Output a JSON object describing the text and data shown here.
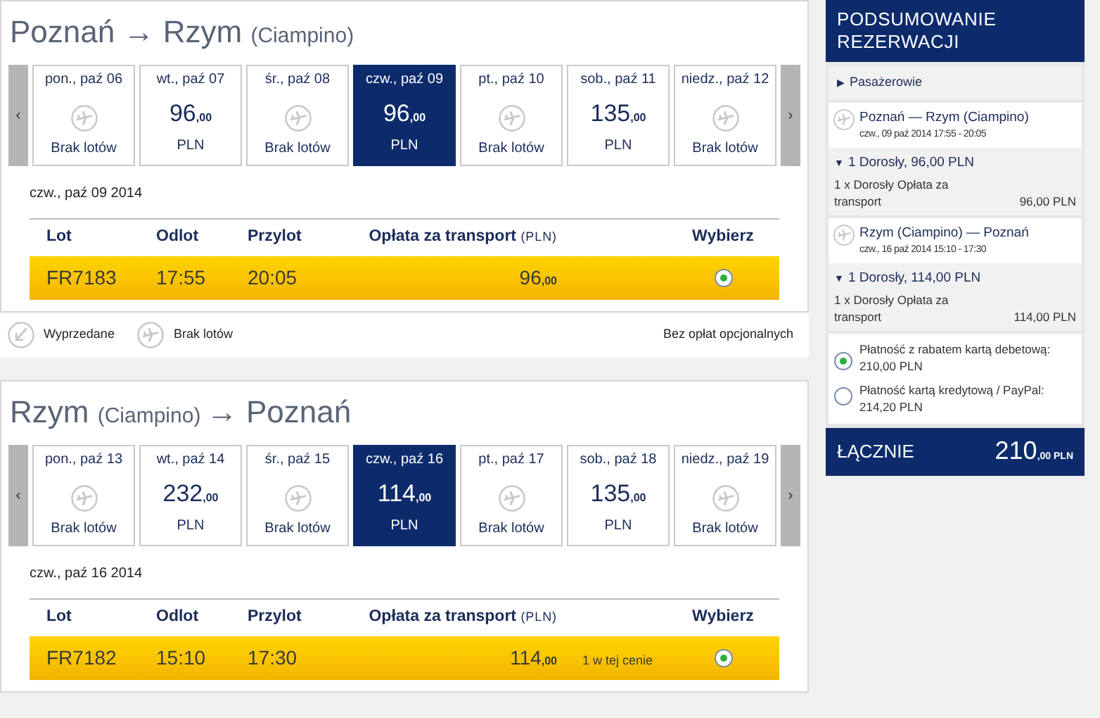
{
  "journeys": [
    {
      "title": [
        {
          "kind": "city",
          "text": "Poznań"
        },
        {
          "kind": "arrow",
          "text": "→"
        },
        {
          "kind": "city",
          "text": "Rzym"
        },
        {
          "kind": "sub",
          "text": "(Ciampino)"
        }
      ],
      "prev": "‹",
      "next": "›",
      "days": [
        {
          "label": "pon., paź 06",
          "kind": "none",
          "text": "Brak lotów",
          "selected": false
        },
        {
          "label": "wt., paź 07",
          "kind": "price",
          "amount": "96",
          "decimals": ",00",
          "currency": "PLN",
          "selected": false
        },
        {
          "label": "śr., paź 08",
          "kind": "none",
          "text": "Brak lotów",
          "selected": false
        },
        {
          "label": "czw., paź 09",
          "kind": "price",
          "amount": "96",
          "decimals": ",00",
          "currency": "PLN",
          "selected": true
        },
        {
          "label": "pt., paź 10",
          "kind": "none",
          "text": "Brak lotów",
          "selected": false
        },
        {
          "label": "sob., paź 11",
          "kind": "price",
          "amount": "135",
          "decimals": ",00",
          "currency": "PLN",
          "selected": false
        },
        {
          "label": "niedz., paź 12",
          "kind": "none",
          "text": "Brak lotów",
          "selected": false
        }
      ],
      "date": "czw., paź 09 2014",
      "columns": [
        "Lot",
        "Odlot",
        "Przylot",
        "Opłata za transport",
        "(PLN)",
        "Wybierz"
      ],
      "flights": [
        {
          "number": "FR7183",
          "departure": "17:55",
          "arrival": "20:05",
          "amount": "96",
          "decimals": ",00",
          "selected": true
        }
      ],
      "legend": {
        "sold_out": "Wyprzedane",
        "no_flights": "Brak lotów",
        "note": "Bez opłat opcjonalnych"
      }
    },
    {
      "title": [
        {
          "kind": "city",
          "text": "Rzym"
        },
        {
          "kind": "sub",
          "text": "(Ciampino)"
        },
        {
          "kind": "arrow",
          "text": "→"
        },
        {
          "kind": "city",
          "text": "Poznań"
        }
      ],
      "prev": "‹",
      "next": "›",
      "days": [
        {
          "label": "pon., paź 13",
          "kind": "none",
          "text": "Brak lotów",
          "selected": false
        },
        {
          "label": "wt., paź 14",
          "kind": "price",
          "amount": "232",
          "decimals": ",00",
          "currency": "PLN",
          "selected": false
        },
        {
          "label": "śr., paź 15",
          "kind": "none",
          "text": "Brak lotów",
          "selected": false
        },
        {
          "label": "czw., paź 16",
          "kind": "price",
          "amount": "114",
          "decimals": ",00",
          "currency": "PLN",
          "selected": true
        },
        {
          "label": "pt., paź 17",
          "kind": "none",
          "text": "Brak lotów",
          "selected": false
        },
        {
          "label": "sob., paź 18",
          "kind": "price",
          "amount": "135",
          "decimals": ",00",
          "currency": "PLN",
          "selected": false
        },
        {
          "label": "niedz., paź 19",
          "kind": "none",
          "text": "Brak lotów",
          "selected": false
        }
      ],
      "date": "czw., paź 16 2014",
      "columns": [
        "Lot",
        "Odlot",
        "Przylot",
        "Opłata za transport",
        "(PLN)",
        "Wybierz"
      ],
      "flights": [
        {
          "number": "FR7182",
          "departure": "15:10",
          "arrival": "17:30",
          "amount": "114",
          "decimals": ",00",
          "note": "1 w tej cenie",
          "selected": true
        }
      ]
    }
  ],
  "summary": {
    "title": "PODSUMOWANIE REZERWACJI",
    "passengers": {
      "marker": "▶",
      "label": "Pasażerowie"
    },
    "segments": [
      {
        "route": "Poznań — Rzym (Ciampino)",
        "details": "czw., 09 paź 2014 17:55 - 20:05",
        "fare_marker": "▼",
        "fare": "1 Dorosły, 96,00 PLN",
        "line": "1 x Dorosły Opłata za transport",
        "line_amount": "96,00 PLN"
      },
      {
        "route": "Rzym (Ciampino) — Poznań",
        "details": "czw., 16 paź 2014 15:10 - 17:30",
        "fare_marker": "▼",
        "fare": "1 Dorosły, 114,00 PLN",
        "line": "1 x Dorosły Opłata za transport",
        "line_amount": "114,00 PLN"
      }
    ],
    "payments": [
      {
        "label": "Płatność z rabatem kartą debetową: 210,00 PLN",
        "selected": true
      },
      {
        "label": "Płatność kartą kredytową / PayPal: 214,20 PLN",
        "selected": false
      }
    ],
    "total": {
      "label": "ŁĄCZNIE",
      "amount": "210",
      "decimals": ",00",
      "currency": "PLN"
    }
  }
}
